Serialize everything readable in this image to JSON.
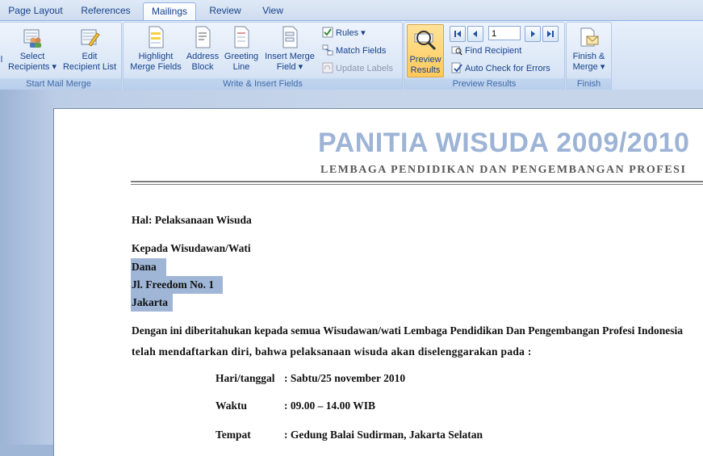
{
  "tabs": [
    {
      "label": "Page Layout",
      "active": false
    },
    {
      "label": "References",
      "active": false
    },
    {
      "label": "Mailings",
      "active": true
    },
    {
      "label": "Review",
      "active": false
    },
    {
      "label": "View",
      "active": false
    }
  ],
  "groups": {
    "start": {
      "label": "Start Mail Merge",
      "partial": "l",
      "select_recipients": [
        "Select",
        "Recipients ▾"
      ],
      "edit_recipient_list": [
        "Edit",
        "Recipient List"
      ]
    },
    "write": {
      "label": "Write & Insert Fields",
      "highlight": [
        "Highlight",
        "Merge Fields"
      ],
      "address": [
        "Address",
        "Block"
      ],
      "greeting": [
        "Greeting",
        "Line"
      ],
      "insert_field": [
        "Insert Merge",
        "Field ▾"
      ],
      "rules": "Rules ▾",
      "match_fields": "Match Fields",
      "update_labels": "Update Labels"
    },
    "preview": {
      "label": "Preview Results",
      "preview_button": [
        "Preview",
        "Results"
      ],
      "record_number": "1",
      "find_recipient": "Find Recipient",
      "auto_check": "Auto Check for Errors"
    },
    "finish": {
      "label": "Finish",
      "finish_merge": [
        "Finish &",
        "Merge ▾"
      ]
    }
  },
  "document": {
    "title": "PANITIA WISUDA 2009/2010",
    "subtitle": "LEMBAGA PENDIDIKAN DAN PENGEMBANGAN PROFESI",
    "subject": "Hal: Pelaksanaan Wisuda",
    "to": "Kepada Wisudawan/Wati",
    "name": "Dana",
    "address": "Jl. Freedom No. 1",
    "city": "Jakarta",
    "body_line1": "Dengan ini diberitahukan kepada semua Wisudawan/wati Lembaga Pendidikan Dan Pengembangan Profesi Indonesia",
    "body_line2": "telah mendaftarkan diri, bahwa pelaksanaan wisuda akan diselenggarakan pada :",
    "details": [
      {
        "label": "Hari/tanggal",
        "value": ":  Sabtu/25 november 2010"
      },
      {
        "label": "Waktu",
        "value": ": 09.00 – 14.00 WIB"
      },
      {
        "label": "Tempat",
        "value": ":  Gedung Balai Sudirman, Jakarta Selatan"
      }
    ]
  },
  "colors": {
    "title": "#9db4d6",
    "selection": "#9fb6d6",
    "ribbon_text": "#15428b"
  }
}
